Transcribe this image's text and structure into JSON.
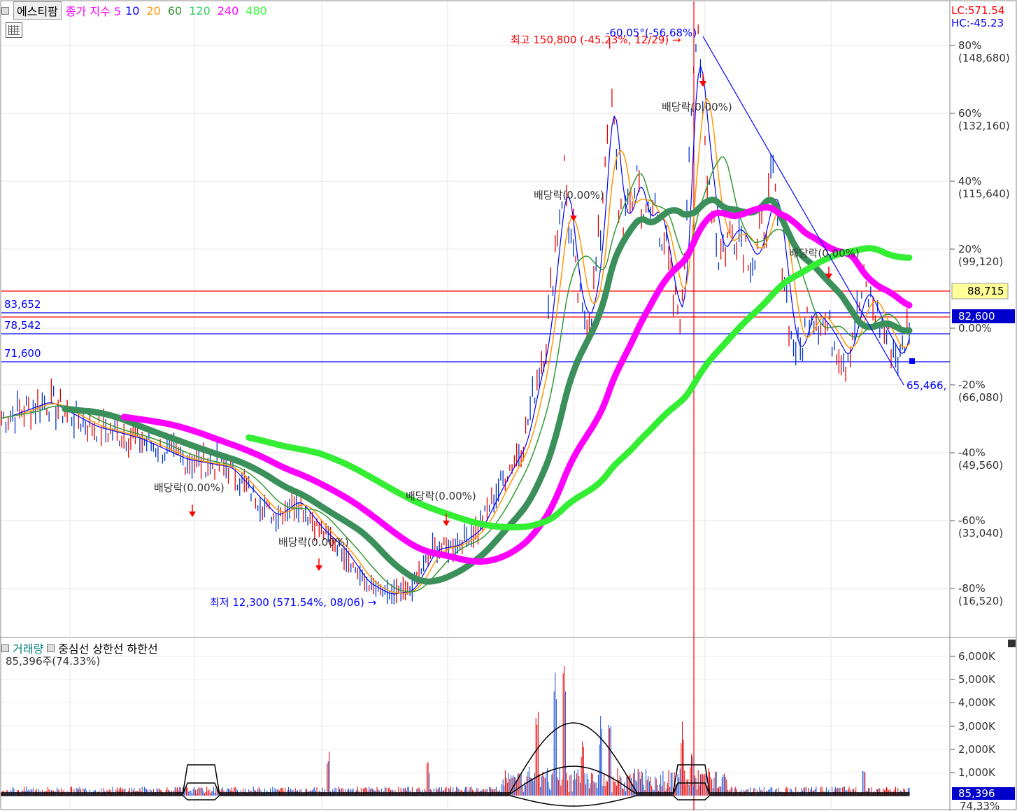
{
  "header": {
    "ticker": "에스티팜",
    "indicator_label": "종가 지수 5",
    "ma_periods": [
      {
        "label": "10",
        "color": "#0000ff"
      },
      {
        "label": "20",
        "color": "#ff9900"
      },
      {
        "label": "60",
        "color": "#339933"
      },
      {
        "label": "120",
        "color": "#33cc66"
      },
      {
        "label": "240",
        "color": "#ff00ff"
      },
      {
        "label": "480",
        "color": "#33ff33"
      }
    ],
    "indicator_color": "#ff00ff"
  },
  "corner": {
    "lc": "LC:571.54",
    "hc": "HC:-45.23"
  },
  "price_axis": {
    "ticks": [
      {
        "pct": "80%",
        "price": "(148,680)"
      },
      {
        "pct": "60%",
        "price": "(132,160)"
      },
      {
        "pct": "40%",
        "price": "(115,640)"
      },
      {
        "pct": "20%",
        "price": "(99,120)"
      },
      {
        "pct": "0.00%",
        "price": ""
      },
      {
        "pct": "-20%",
        "price": "(66,080)"
      },
      {
        "pct": "-40%",
        "price": "(49,560)"
      },
      {
        "pct": "-60%",
        "price": "(33,040)"
      },
      {
        "pct": "-80%",
        "price": "(16,520)"
      }
    ],
    "badge_red": "88,715",
    "badge_blue": "82,600"
  },
  "levels": {
    "l83652": "83,652",
    "l78542": "78,542",
    "l71600": "71,600",
    "l65466": "65,466,"
  },
  "annotations": {
    "high": "최고 150,800 (-45.23%, 12/29) →",
    "low": "최저 12,300 (571.54%, 08/06) →",
    "trend": "-60.05°(-56.68%)",
    "div1": "배당락(0.00%)",
    "div2": "배당락(0.00%)",
    "div3": "배당락(0.00%)",
    "div4": "배당락(0.00%)",
    "div5": "배당락(0.00%)",
    "div6": "배당락(0.00%)"
  },
  "volume": {
    "title": "거래량",
    "items": [
      "중심선",
      "상한선",
      "하한선"
    ],
    "current": "85,396주(74.33%)",
    "axis": [
      "6,000K",
      "5,000K",
      "4,000K",
      "3,000K",
      "2,000K",
      "1,000K"
    ],
    "badge": "85,396",
    "badge_pct": "74.33%"
  },
  "chart_data": {
    "type": "line",
    "price_high": 150800,
    "price_low": 12300,
    "price_close_marker": 82600,
    "price_series_approx": [
      [
        0,
        58000
      ],
      [
        10,
        62000
      ],
      [
        20,
        56000
      ],
      [
        30,
        53000
      ],
      [
        40,
        48000
      ],
      [
        50,
        46000
      ],
      [
        60,
        34000
      ],
      [
        65,
        38000
      ],
      [
        70,
        31000
      ],
      [
        75,
        26000
      ],
      [
        80,
        18000
      ],
      [
        85,
        15000
      ],
      [
        90,
        16000
      ],
      [
        95,
        26000
      ],
      [
        100,
        27000
      ],
      [
        105,
        31000
      ],
      [
        110,
        42000
      ],
      [
        115,
        52000
      ],
      [
        118,
        68000
      ],
      [
        120,
        77000
      ],
      [
        122,
        100000
      ],
      [
        124,
        118000
      ],
      [
        126,
        95000
      ],
      [
        128,
        82000
      ],
      [
        130,
        85000
      ],
      [
        132,
        104000
      ],
      [
        134,
        142000
      ],
      [
        136,
        110000
      ],
      [
        138,
        106000
      ],
      [
        140,
        118000
      ],
      [
        142,
        105000
      ],
      [
        144,
        110000
      ],
      [
        146,
        102000
      ],
      [
        148,
        86000
      ],
      [
        150,
        84000
      ],
      [
        152,
        140000
      ],
      [
        153,
        150800
      ],
      [
        155,
        125000
      ],
      [
        158,
        98000
      ],
      [
        162,
        105000
      ],
      [
        166,
        96000
      ],
      [
        170,
        115000
      ],
      [
        172,
        98000
      ],
      [
        174,
        77000
      ],
      [
        176,
        74000
      ],
      [
        178,
        85000
      ],
      [
        182,
        80000
      ],
      [
        186,
        72000
      ],
      [
        190,
        90000
      ],
      [
        194,
        80000
      ],
      [
        198,
        72000
      ],
      [
        200,
        82600
      ]
    ]
  }
}
